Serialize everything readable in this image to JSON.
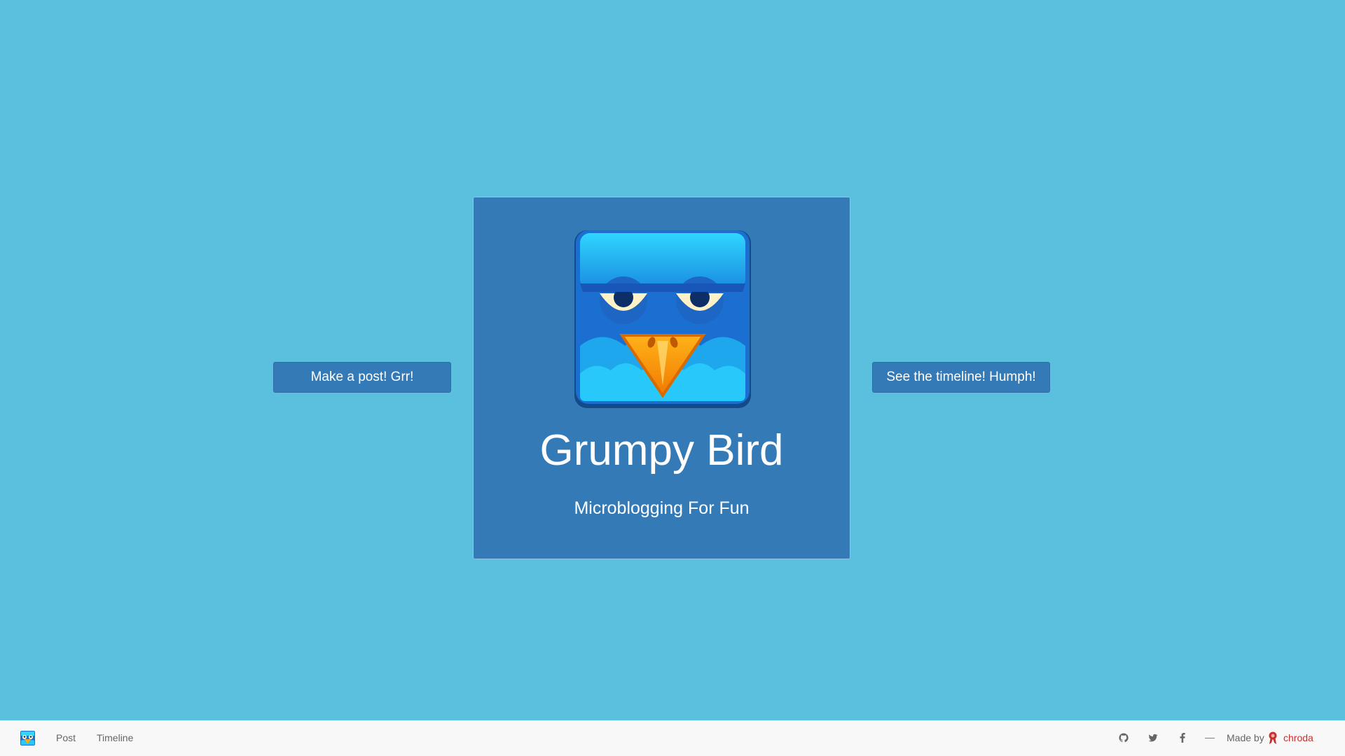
{
  "actions": {
    "post_button": "Make a post! Grr!",
    "timeline_button": "See the timeline! Humph!"
  },
  "hero": {
    "title": "Grumpy Bird",
    "subtitle": "Microblogging For Fun",
    "logo_icon": "grumpy-bird-logo"
  },
  "footer": {
    "brand_icon": "grumpy-bird-logo",
    "nav": [
      "Post",
      "Timeline"
    ],
    "social_icons": [
      "github-icon",
      "twitter-icon",
      "facebook-icon"
    ],
    "separator": "—",
    "made_by": "Made by",
    "maker_name": "chroda"
  },
  "colors": {
    "background": "#5bc0de",
    "primary": "#337ab7",
    "footer_bg": "#f8f8f8",
    "maker_link": "#c9302c"
  }
}
